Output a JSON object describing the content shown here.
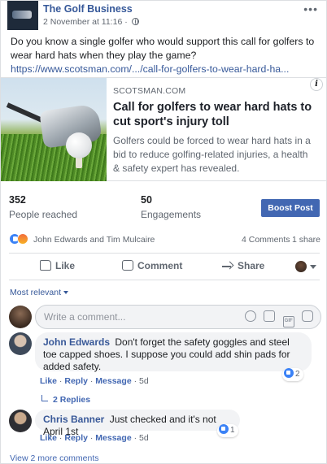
{
  "post": {
    "page_name": "The Golf Business",
    "timestamp": "2 November at 11:16 ·",
    "more_icon": "more-horizontal-icon",
    "text": "Do you know a single golfer who would support this call for golfers to wear hard hats when they play the game?",
    "link": "https://www.scotsman.com/.../call-for-golfers-to-wear-hard-ha..."
  },
  "preview": {
    "domain": "SCOTSMAN.COM",
    "title": "Call for golfers to wear hard hats to cut sport's injury toll",
    "description": "Golfers could be forced to wear hard hats in a bid to reduce golfing-related injuries, a health & safety expert has revealed.",
    "info_label": "i"
  },
  "stats": {
    "reached_value": "352",
    "reached_label": "People reached",
    "engagements_value": "50",
    "engagements_label": "Engagements",
    "boost_label": "Boost Post"
  },
  "reactions": {
    "names": "John Edwards and Tim Mulcaire",
    "comments": "4 Comments",
    "shares": "1 share"
  },
  "actions": {
    "like": "Like",
    "comment": "Comment",
    "share": "Share"
  },
  "comments_section": {
    "sort_label": "Most relevant",
    "input_placeholder": "Write a comment...",
    "gif_label": "GIF",
    "comments": [
      {
        "author": "John Edwards",
        "text": "Don't forget the safety goggles and steel toe capped shoes. I suppose you could add shin pads for added safety.",
        "like": "Like",
        "reply": "Reply",
        "message": "Message",
        "age": "5d",
        "reaction_count": "2",
        "replies": "2 Replies"
      },
      {
        "author": "Chris Banner",
        "text": "Just checked and it's not April 1st",
        "like": "Like",
        "reply": "Reply",
        "message": "Message",
        "age": "5d",
        "reaction_count": "1"
      }
    ],
    "view_more": "View 2 more comments"
  },
  "colors": {
    "link_blue": "#365899",
    "boost_button": "#4267b2",
    "bubble_bg": "#f2f3f5",
    "meta_gray": "#606770"
  }
}
